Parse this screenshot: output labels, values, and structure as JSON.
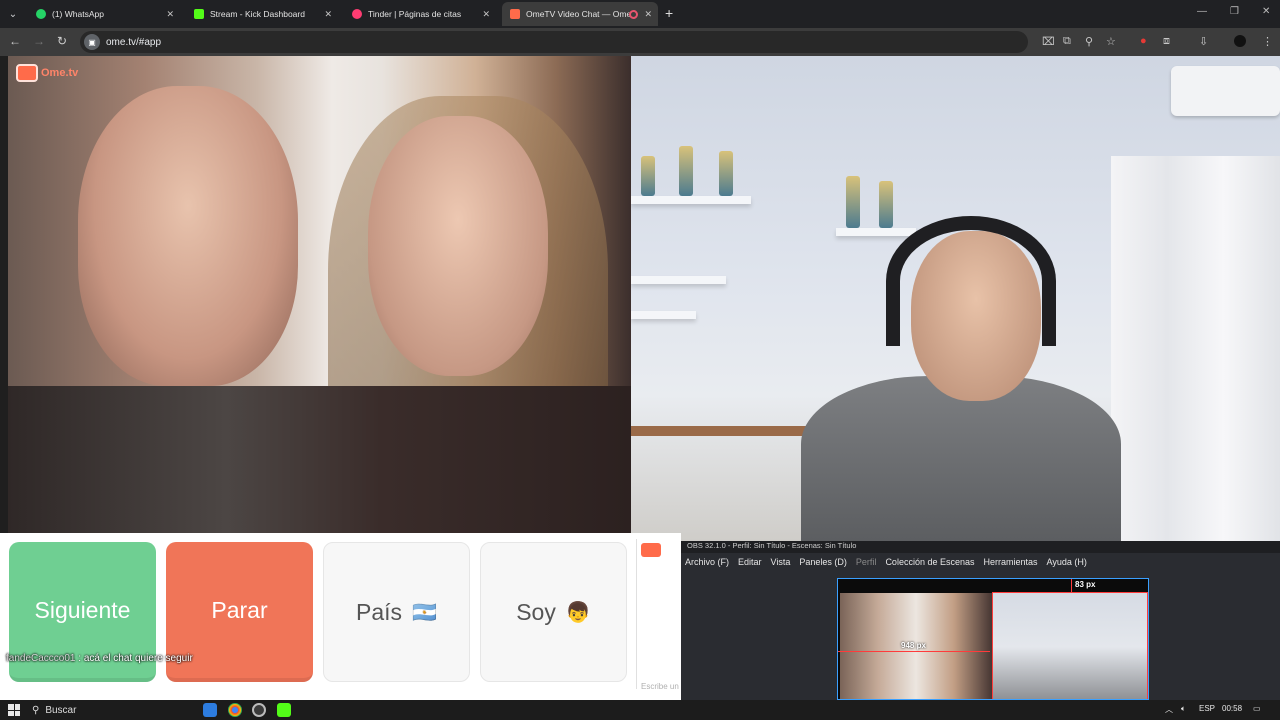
{
  "browser": {
    "tabs": [
      {
        "label": "(1) WhatsApp",
        "icon": "whatsapp-icon",
        "color": "#25d366"
      },
      {
        "label": "Stream - Kick Dashboard",
        "icon": "kick-icon",
        "color": "#53fc18"
      },
      {
        "label": "Tinder | Páginas de citas",
        "icon": "tinder-icon",
        "color": "#fe3c72"
      },
      {
        "label": "OmeTV Video Chat — Ome",
        "icon": "ometv-icon",
        "color": "#ff6b4a"
      }
    ],
    "url": "ome.tv/#app"
  },
  "ometv": {
    "logo_text": "Ome.tv",
    "buttons": {
      "next": "Siguiente",
      "stop": "Parar",
      "country": "País",
      "country_flag": "🇦🇷",
      "gender": "Soy",
      "gender_emoji": "👦"
    },
    "chat_placeholder": "Escribe un",
    "chat_message": {
      "user": "fandeCaccco01",
      "text": ": acá el chat quiere seguir"
    }
  },
  "obs": {
    "title": "OBS 32.1.0 - Perfil: Sin Título - Escenas: Sin Título",
    "menu": [
      "Archivo (F)",
      "Editar",
      "Vista",
      "Paneles (D)",
      "Perfil",
      "Colección de Escenas",
      "Herramientas",
      "Ayuda (H)"
    ],
    "px_top": "83 px",
    "px_left": "948 px"
  },
  "taskbar": {
    "search": "Buscar",
    "lang": "ESP",
    "time": "00:58"
  }
}
